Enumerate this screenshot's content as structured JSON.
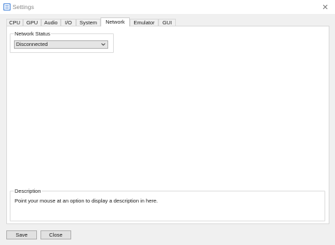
{
  "window": {
    "title": "Settings",
    "close_glyph": "✕"
  },
  "tabs": [
    {
      "label": "CPU",
      "active": false
    },
    {
      "label": "GPU",
      "active": false
    },
    {
      "label": "Audio",
      "active": false
    },
    {
      "label": "I/O",
      "active": false
    },
    {
      "label": "System",
      "active": false
    },
    {
      "label": "Network",
      "active": true
    },
    {
      "label": "Emulator",
      "active": false
    },
    {
      "label": "GUI",
      "active": false
    }
  ],
  "network": {
    "group_label": "Network Status",
    "status_selected": "Disconnected"
  },
  "description": {
    "group_label": "Description",
    "text": "Point your mouse at an option to display a description in here."
  },
  "footer": {
    "save_label": "Save",
    "close_label": "Close"
  },
  "colors": {
    "accent": "#0078d7",
    "window_bg": "#f0f0f0",
    "panel_bg": "#ffffff"
  }
}
